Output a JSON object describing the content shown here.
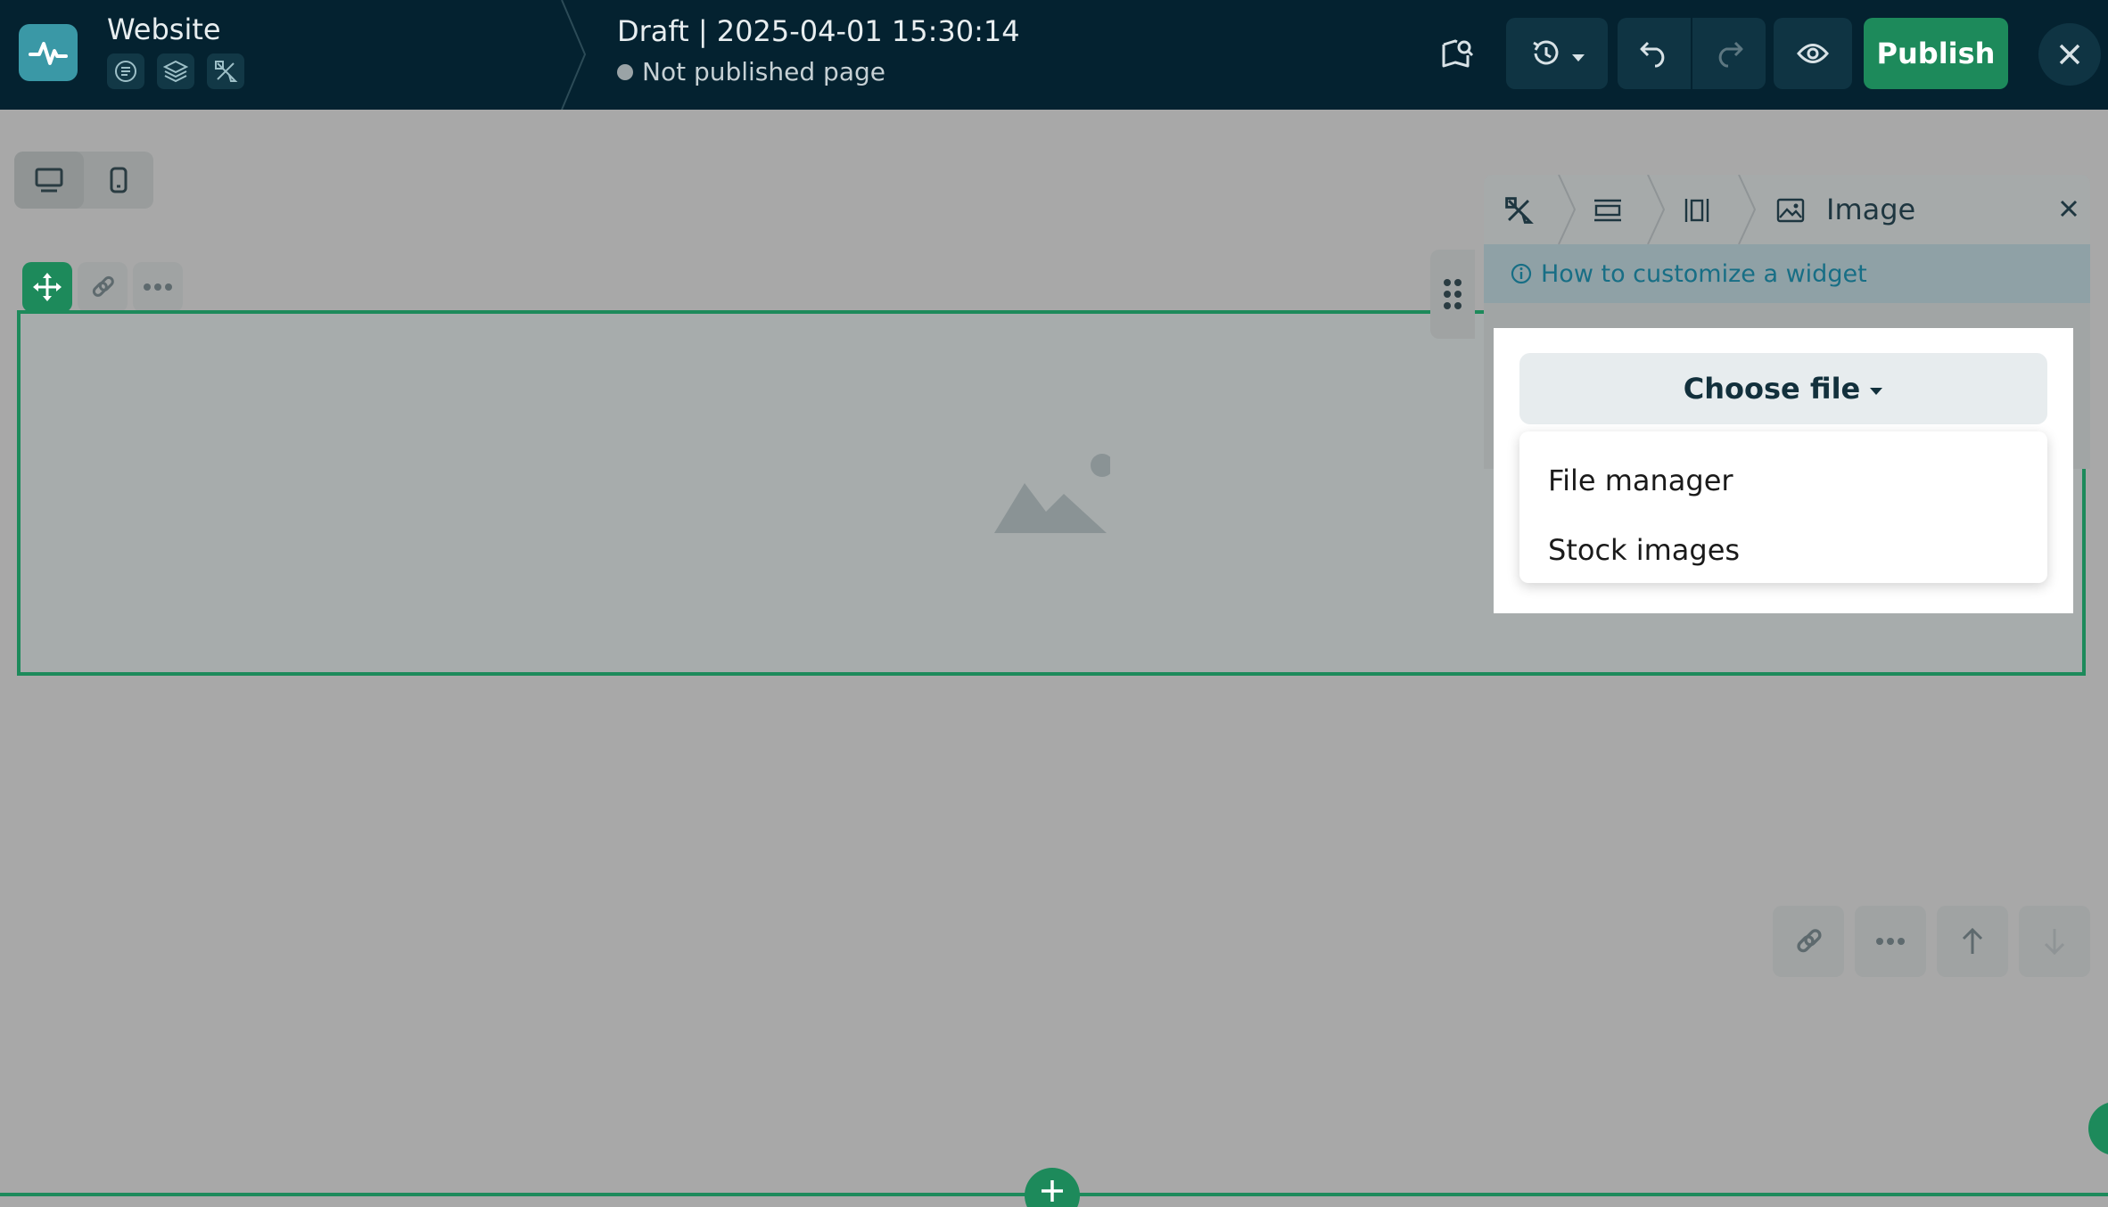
{
  "header": {
    "site_name": "Website",
    "draft_title": "Draft | 2025-04-01 15:30:14",
    "status_text": "Not published page",
    "publish_label": "Publish"
  },
  "panel": {
    "title": "Image",
    "help_link": "How to customize a widget",
    "choose_file_label": "Choose file",
    "dropdown_items": [
      "File manager",
      "Stock images"
    ]
  },
  "colors": {
    "topbar": "#042230",
    "accent_green": "#1d8a5b",
    "help_link": "#176e85"
  },
  "icons": {
    "logo": "pulse-icon",
    "site_tools": [
      "page-icon",
      "layers-icon",
      "design-tools-icon"
    ],
    "toolbar": [
      "book-search-icon",
      "history-icon",
      "undo-icon",
      "redo-icon",
      "eye-icon",
      "close-icon"
    ],
    "panel_breadcrumbs": [
      "design-tools-icon",
      "section-icon",
      "column-icon",
      "image-icon"
    ]
  }
}
